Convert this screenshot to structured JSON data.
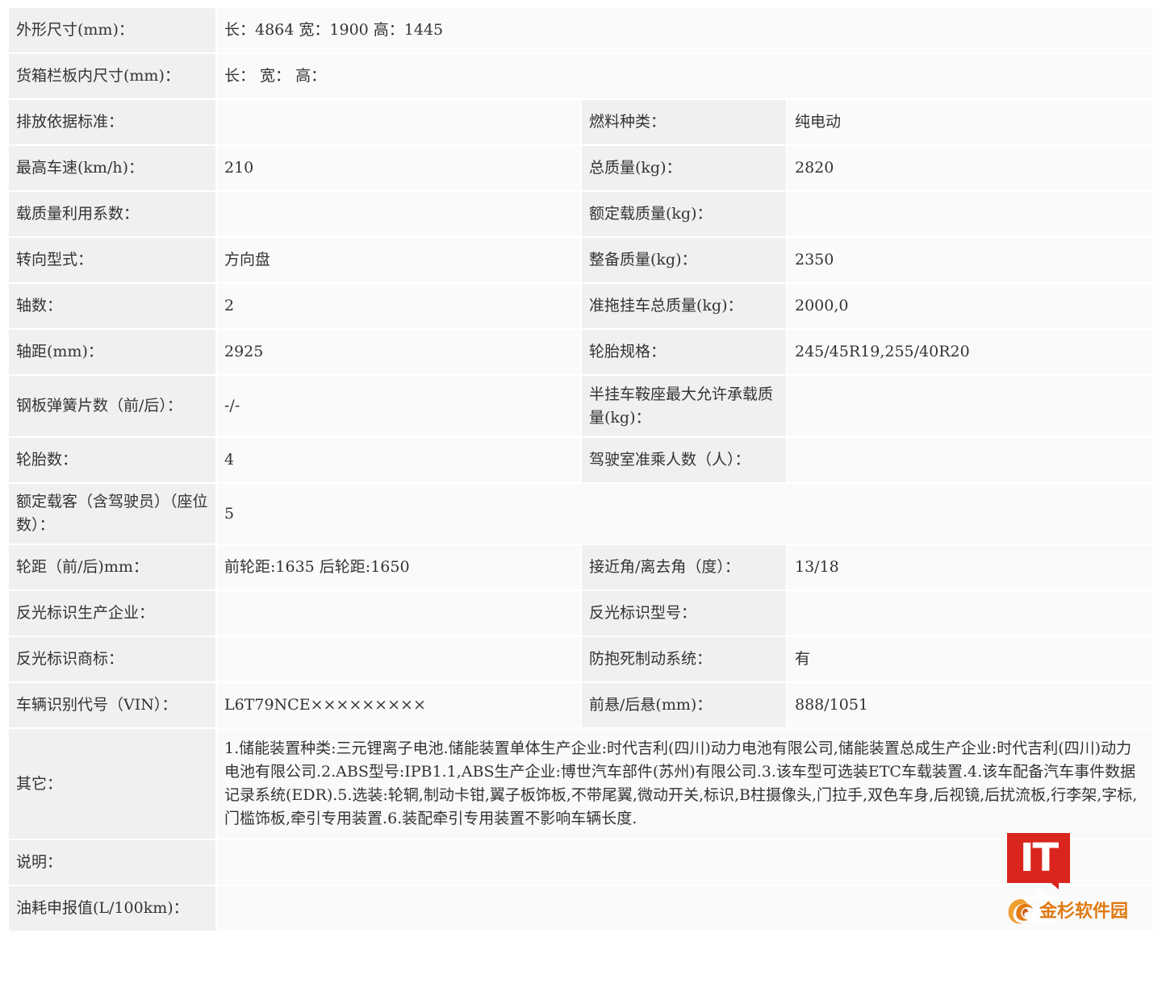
{
  "rows": [
    {
      "label": "外形尺寸(mm)：",
      "value": "长：4864 宽：1900 高：1445"
    },
    {
      "label": "货箱栏板内尺寸(mm)：",
      "value": "长： 宽： 高："
    },
    {
      "label": "排放依据标准：",
      "value": "",
      "label2": "燃料种类：",
      "value2": "纯电动"
    },
    {
      "label": "最高车速(km/h)：",
      "value": "210",
      "label2": "总质量(kg)：",
      "value2": "2820"
    },
    {
      "label": "载质量利用系数：",
      "value": "",
      "label2": "额定载质量(kg)：",
      "value2": ""
    },
    {
      "label": "转向型式：",
      "value": "方向盘",
      "label2": "整备质量(kg)：",
      "value2": "2350"
    },
    {
      "label": "轴数：",
      "value": "2",
      "label2": "准拖挂车总质量(kg)：",
      "value2": "2000,0"
    },
    {
      "label": "轴距(mm)：",
      "value": "2925",
      "label2": "轮胎规格：",
      "value2": "245/45R19,255/40R20"
    },
    {
      "label": "钢板弹簧片数（前/后）：",
      "value": "-/-",
      "label2": "半挂车鞍座最大允许承载质量(kg)：",
      "value2": ""
    },
    {
      "label": "轮胎数：",
      "value": "4",
      "label2": "驾驶室准乘人数（人）：",
      "value2": ""
    },
    {
      "label": "额定载客（含驾驶员）（座位数）：",
      "value": "5"
    },
    {
      "label": "轮距（前/后)mm：",
      "value": "前轮距:1635 后轮距:1650",
      "label2": "接近角/离去角（度）：",
      "value2": "13/18"
    },
    {
      "label": "反光标识生产企业：",
      "value": "",
      "label2": "反光标识型号：",
      "value2": ""
    },
    {
      "label": "反光标识商标：",
      "value": "",
      "label2": "防抱死制动系统：",
      "value2": "有"
    },
    {
      "label": "车辆识别代号（VIN）：",
      "value": "L6T79NCE×××××××××",
      "label2": "前悬/后悬(mm)：",
      "value2": "888/1051"
    },
    {
      "label": "其它：",
      "value": "1.储能装置种类:三元锂离子电池.储能装置单体生产企业:时代吉利(四川)动力电池有限公司,储能装置总成生产企业:时代吉利(四川)动力电池有限公司.2.ABS型号:IPB1.1,ABS生产企业:博世汽车部件(苏州)有限公司.3.该车型可选装ETC车载装置.4.该车配备汽车事件数据记录系统(EDR).5.选装:轮辋,制动卡钳,翼子板饰板,不带尾翼,微动开关,标识,B柱摄像头,门拉手,双色车身,后视镜,后扰流板,行李架,字标,门槛饰板,牵引专用装置.6.装配牵引专用装置不影响车辆长度."
    },
    {
      "label": "说明：",
      "value": ""
    },
    {
      "label": "油耗申报值(L/100km)：",
      "value": ""
    }
  ],
  "watermark": {
    "brand": "IT之家",
    "site": "金杉软件园",
    "brand_color": "#d9251d",
    "site_color": "#e07a12"
  }
}
